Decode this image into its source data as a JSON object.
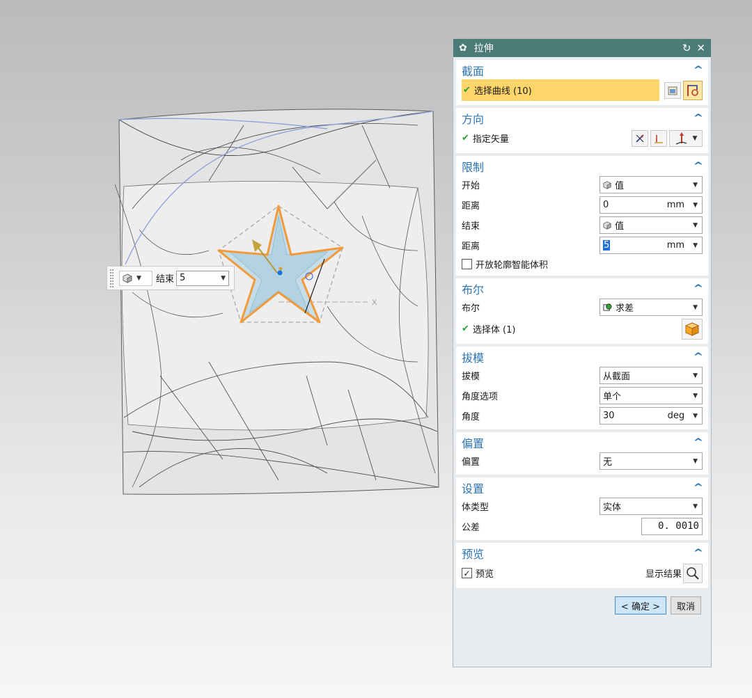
{
  "dialog": {
    "title": "拉伸",
    "reset_icon": "reset-icon",
    "close_icon": "close-icon"
  },
  "section_curve": {
    "title": "截面",
    "select_curve": "选择曲线 (10)"
  },
  "section_direction": {
    "title": "方向",
    "specify_vector": "指定矢量"
  },
  "section_limits": {
    "title": "限制",
    "start_label": "开始",
    "start_value": "值",
    "start_distance_label": "距离",
    "start_distance": "0",
    "start_unit": "mm",
    "end_label": "结束",
    "end_value": "值",
    "end_distance_label": "距离",
    "end_distance": "5",
    "end_unit": "mm",
    "open_profile": "开放轮廓智能体积",
    "open_profile_checked": false
  },
  "section_boolean": {
    "title": "布尔",
    "boolean_label": "布尔",
    "boolean_value": "求差",
    "select_body": "选择体 (1)"
  },
  "section_draft": {
    "title": "拔模",
    "draft_label": "拔模",
    "draft_value": "从截面",
    "angle_option_label": "角度选项",
    "angle_option_value": "单个",
    "angle_label": "角度",
    "angle_value": "30",
    "angle_unit": "deg"
  },
  "section_offset": {
    "title": "偏置",
    "offset_label": "偏置",
    "offset_value": "无"
  },
  "section_settings": {
    "title": "设置",
    "body_type_label": "体类型",
    "body_type_value": "实体",
    "tolerance_label": "公差",
    "tolerance_value": "0. 0010"
  },
  "section_preview": {
    "title": "预览",
    "preview_label": "预览",
    "preview_checked": true,
    "show_result": "显示结果"
  },
  "buttons": {
    "ok": "< 确定 >",
    "cancel": "取消"
  },
  "mini_toolbar": {
    "end_label": "结束",
    "end_value": "5"
  },
  "viewport": {
    "axis_x_label": "X"
  },
  "colors": {
    "title_bar": "#4c7c78",
    "section_title": "#2c74b3",
    "selection_highlight": "#fdd56a",
    "star_outline": "#f29a3a",
    "check_green": "#2ea12e"
  }
}
